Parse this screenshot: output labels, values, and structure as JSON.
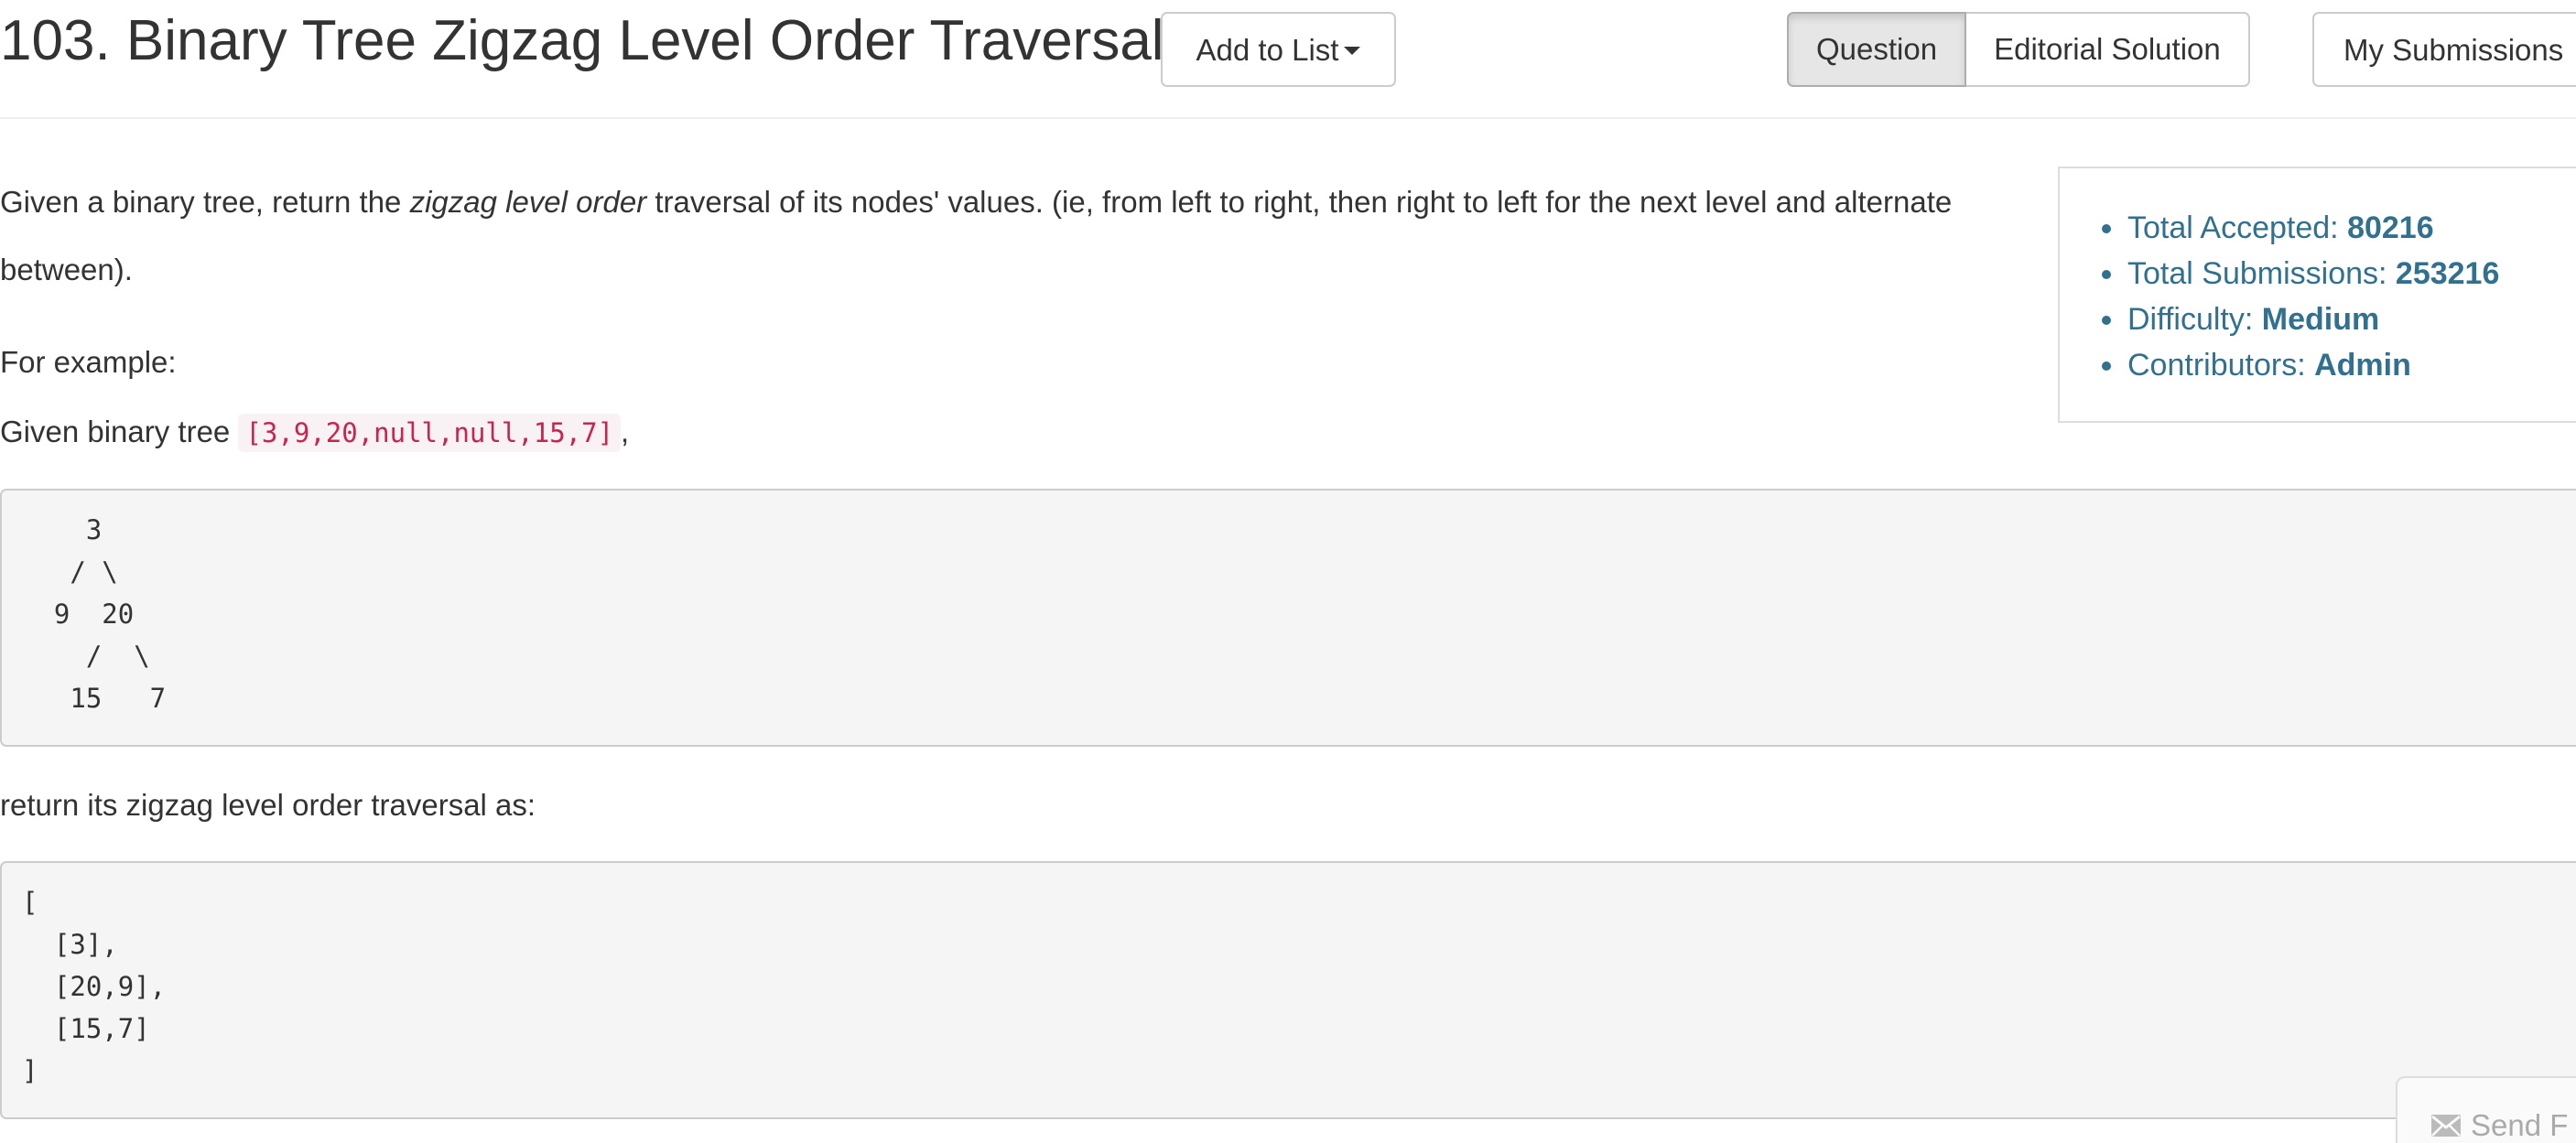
{
  "header": {
    "title": "103. Binary Tree Zigzag Level Order Traversal",
    "add_to_list": "Add to List",
    "tabs": [
      "Question",
      "Editorial Solution"
    ],
    "active_tab": "Question",
    "my_submissions": "My Submissions"
  },
  "description": {
    "before_em": "Given a binary tree, return the ",
    "em": "zigzag level order",
    "after_em": " traversal of its nodes' values. (ie, from left to right, then right to left for the next level and alternate between).",
    "for_example": "For example:",
    "given_prefix": "Given binary tree ",
    "given_code": "[3,9,20,null,null,15,7]",
    "given_suffix": ",",
    "tree_block": "    3\n   / \\\n  9  20\n    /  \\\n   15   7",
    "return_text": "return its zigzag level order traversal as:",
    "result_block": "[\n  [3],\n  [20,9],\n  [15,7]\n]"
  },
  "stats": {
    "accepted_label": "Total Accepted:",
    "accepted_value": "80216",
    "submissions_label": "Total Submissions:",
    "submissions_value": "253216",
    "difficulty_label": "Difficulty:",
    "difficulty_value": "Medium",
    "contributors_label": "Contributors:",
    "contributors_value": "Admin"
  },
  "feedback": {
    "label": "Send F",
    "icon": "envelope-icon"
  },
  "colors": {
    "stats_text": "#31708f",
    "inline_code": "#c7254e",
    "pre_background": "#f5f5f5"
  }
}
